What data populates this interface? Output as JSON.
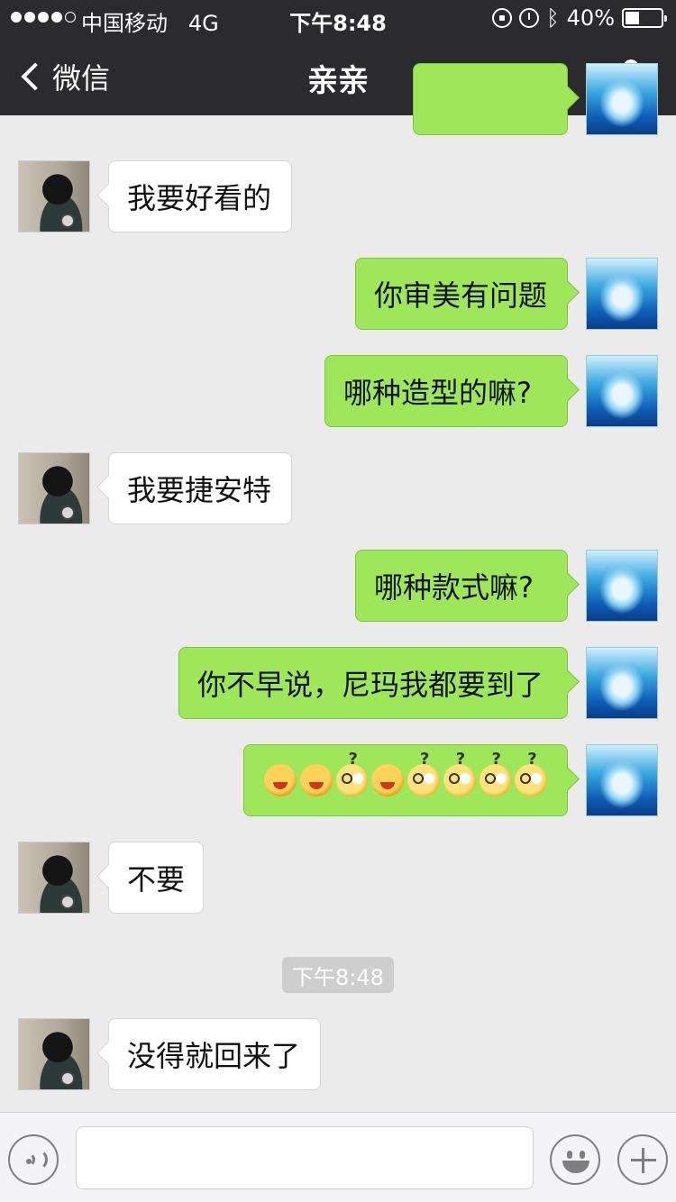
{
  "status_bar": {
    "carrier": "中国移动",
    "network": "4G",
    "time": "下午8:48",
    "battery": "40%",
    "battery_level": 0.4,
    "icons": [
      "signal-icon",
      "rotation-lock-icon",
      "alarm-icon",
      "bluetooth-icon",
      "battery-icon"
    ]
  },
  "nav": {
    "back_label": "微信",
    "title": "亲亲",
    "right_icon": "profile-icon"
  },
  "messages": [
    {
      "side": "left",
      "text": "我要好看的"
    },
    {
      "side": "right",
      "text": "你审美有问题"
    },
    {
      "side": "right",
      "text": "哪种造型的嘛?"
    },
    {
      "side": "left",
      "text": "我要捷安特"
    },
    {
      "side": "right",
      "text": "哪种款式嘛?"
    },
    {
      "side": "right",
      "text": "你不早说，尼玛我都要到了"
    },
    {
      "side": "right",
      "emojis": [
        "angry",
        "angry",
        "dizzy",
        "angry",
        "dizzy",
        "dizzy",
        "dizzy",
        "dizzy"
      ]
    },
    {
      "side": "left",
      "text": "不要"
    },
    {
      "timestamp": "下午8:48"
    },
    {
      "side": "left",
      "text": "没得就回来了"
    }
  ],
  "input": {
    "placeholder": "",
    "value": ""
  },
  "colors": {
    "header_bg": "#2b2b2d",
    "chat_bg": "#ebebeb",
    "bubble_right": "#9ee75a",
    "bubble_left": "#ffffff"
  }
}
